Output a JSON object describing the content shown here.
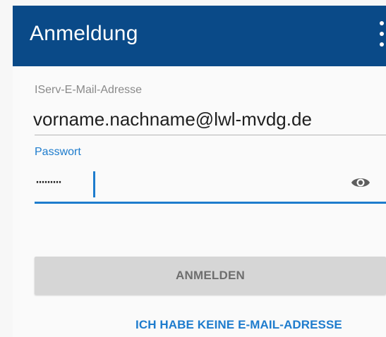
{
  "appbar": {
    "title": "Anmeldung",
    "background_color": "#0a4a88",
    "menu_icon": "more-vert-icon"
  },
  "form": {
    "email": {
      "label": "IServ-E-Mail-Adresse",
      "value": "vorname.nachname@lwl-mvdg.de"
    },
    "password": {
      "label": "Passwort",
      "masked_value": "·········",
      "visibility_icon": "eye-icon",
      "focused": true
    },
    "accent_color": "#1e7ccd"
  },
  "actions": {
    "login_label": "ANMELDEN",
    "no_email_label": "ICH HABE KEINE E-MAIL-ADRESSE"
  }
}
